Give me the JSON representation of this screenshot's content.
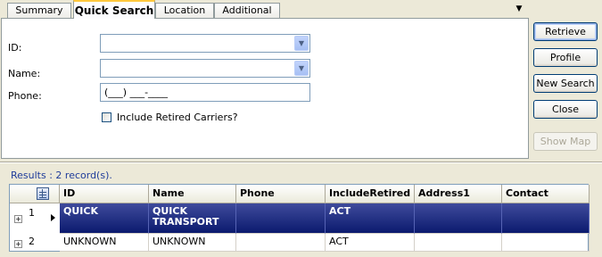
{
  "tabs": [
    {
      "label": "Summary"
    },
    {
      "label": "Quick Search"
    },
    {
      "label": "Location"
    },
    {
      "label": "Additional"
    }
  ],
  "form": {
    "id_label": "ID:",
    "name_label": "Name:",
    "phone_label": "Phone:",
    "phone_value": "(___) ___-____",
    "include_retired_label": "Include Retired Carriers?",
    "include_retired_checked": false
  },
  "buttons": {
    "retrieve": "Retrieve",
    "profile": "Profile",
    "new_search": "New Search",
    "close": "Close",
    "show_map": "Show Map"
  },
  "results": {
    "summary": "Results : 2 record(s).",
    "columns": [
      "ID",
      "Name",
      "Phone",
      "IncludeRetired",
      "Address1",
      "Contact"
    ],
    "rows": [
      {
        "num": "1",
        "id": "QUICK",
        "name": "QUICK TRANSPORT",
        "phone": "",
        "include_retired": "ACT",
        "address1": "",
        "contact": "",
        "selected": true
      },
      {
        "num": "2",
        "id": "UNKNOWN",
        "name": "UNKNOWN",
        "phone": "",
        "include_retired": "ACT",
        "address1": "",
        "contact": "",
        "selected": false
      }
    ]
  },
  "icons": {
    "tab_menu": "chevron-down-icon",
    "combo_arrow": "chevron-down-icon",
    "grid_corner": "column-chooser-icon",
    "row_expander": "plus-icon",
    "row_pointer": "current-row-arrow-icon"
  },
  "colors": {
    "selection": "#0b1a6e",
    "active_tab_accent": "#ffc83c",
    "results_text": "#1f3c9a"
  }
}
